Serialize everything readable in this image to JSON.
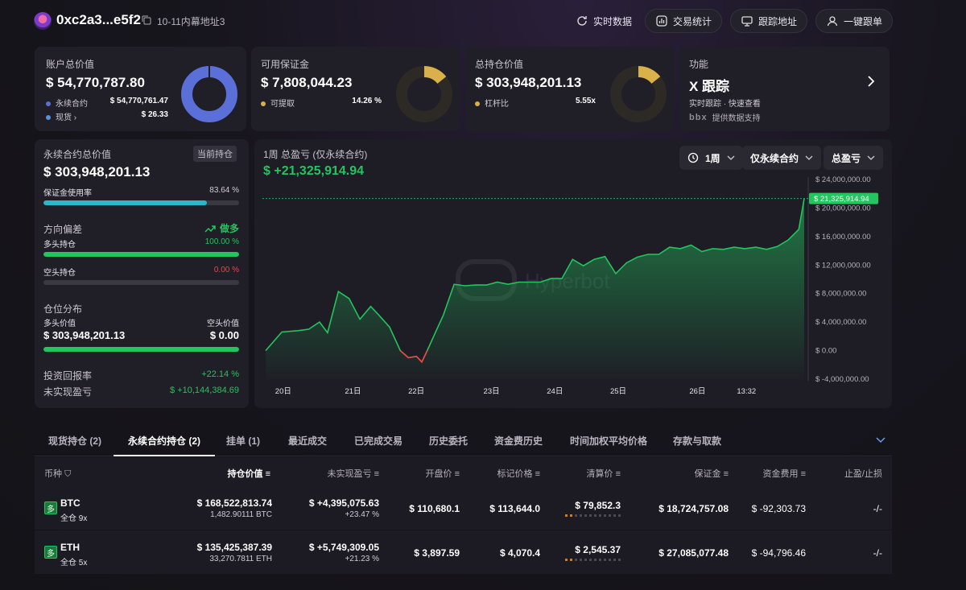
{
  "header": {
    "address": "0xc2a3...e5f2",
    "address_note": "10-11内幕地址3",
    "realtime_label": "实时数据",
    "trade_stats_label": "交易统计",
    "track_address_label": "跟踪地址",
    "copy_trade_label": "一键跟单"
  },
  "cards": {
    "account": {
      "label": "账户总价值",
      "value": "$ 54,770,787.80",
      "perp_label": "永续合约",
      "perp_value": "$ 54,770,761.47",
      "spot_label": "现货",
      "spot_value": "$ 26.33",
      "colors": {
        "perp": "#5b6fd8",
        "spot": "#5b8fe0"
      },
      "ring_fraction": 0.9999
    },
    "margin": {
      "label": "可用保证金",
      "value": "$ 7,808,044.23",
      "withdraw_label": "可提取",
      "withdraw_value": "14.26 %",
      "ring_fraction": 0.1426,
      "color": "#d9b04a"
    },
    "positions": {
      "label": "总持仓价值",
      "value": "$ 303,948,201.13",
      "leverage_label": "杠杆比",
      "leverage_value": "5.55x",
      "ring_fraction": 0.14,
      "color": "#d9b04a"
    },
    "feature": {
      "label": "功能",
      "title": "X 跟踪",
      "desc": "实时跟踪 · 快速查看",
      "provider_logo": "bbx",
      "provider_text": "提供数据支持"
    }
  },
  "left": {
    "perp_total_label": "永续合约总价值",
    "current_pos_label": "当前持仓",
    "perp_total_value": "$ 303,948,201.13",
    "margin_usage_label": "保证金使用率",
    "margin_usage_value": "83.64 %",
    "margin_usage_fraction": 0.8364,
    "direction_label": "方向偏差",
    "direction_value": "做多",
    "long_label": "多头持仓",
    "long_value": "100.00 %",
    "long_fraction": 1.0,
    "short_label": "空头持仓",
    "short_value": "0.00 %",
    "short_fraction": 0.0,
    "distribution_label": "仓位分布",
    "long_value_label": "多头价值",
    "short_value_label": "空头价值",
    "long_amount": "$ 303,948,201.13",
    "short_amount": "$ 0.00",
    "dist_fraction": 1.0,
    "roi_label": "投资回报率",
    "roi_value": "+22.14 %",
    "unrealized_label": "未实现盈亏",
    "unrealized_value": "$ +10,144,384.69"
  },
  "chart_panel": {
    "title": "1周 总盈亏 (仅永续合约)",
    "pnl": "$ +21,325,914.94",
    "period_btn": "1周",
    "scope_btn": "仅永续合约",
    "metric_btn": "总盈亏",
    "watermark": "Hyperbot"
  },
  "chart_data": {
    "type": "area",
    "title": "1周 总盈亏 (仅永续合约)",
    "x_tick_labels": [
      "20日",
      "21日",
      "22日",
      "23日",
      "24日",
      "25日",
      "26日",
      "13:32"
    ],
    "y_tick_labels": [
      "$ 24,000,000.00",
      "$ 20,000,000.00",
      "$ 16,000,000.00",
      "$ 12,000,000.00",
      "$ 8,000,000.00",
      "$ 4,000,000.00",
      "$ 0.00",
      "$ -4,000,000.00"
    ],
    "ylim": [
      -4000000,
      24000000
    ],
    "current_value_label": "$ 21,325,914.94",
    "current_value": 21325914.94,
    "x": [
      0,
      0.3,
      0.6,
      0.8,
      1.0,
      1.15,
      1.35,
      1.55,
      1.75,
      1.95,
      2.1,
      2.3,
      2.5,
      2.65,
      2.8,
      2.9,
      3.0,
      3.15,
      3.3,
      3.5,
      3.7,
      3.9,
      4.1,
      4.3,
      4.5,
      4.7,
      4.9,
      5.1,
      5.3,
      5.5,
      5.7,
      5.9,
      6.1,
      6.3,
      6.5,
      6.7,
      6.9,
      7.1,
      7.3,
      7.5,
      7.7,
      7.9,
      8.1,
      8.3,
      8.5,
      8.7,
      8.9,
      9.1,
      9.3,
      9.5,
      9.7,
      9.9,
      10.0
    ],
    "values": [
      0,
      2600000,
      2800000,
      3000000,
      4000000,
      2500000,
      8300000,
      7300000,
      4400000,
      6200000,
      5000000,
      3300000,
      0,
      -1000000,
      -800000,
      -1600000,
      0,
      2500000,
      5000000,
      9300000,
      9100000,
      9200000,
      9200000,
      9600000,
      9300000,
      9600000,
      9600000,
      9600000,
      10100000,
      10100000,
      12800000,
      11900000,
      12800000,
      13200000,
      10800000,
      12300000,
      13100000,
      13500000,
      13500000,
      14500000,
      14300000,
      14800000,
      13900000,
      14300000,
      14200000,
      14500000,
      14300000,
      14500000,
      14200000,
      14600000,
      15500000,
      17000000,
      21325914.94
    ],
    "series_color": "#22c55e",
    "negative_color": "#ef4444",
    "grid": false
  },
  "tabs": [
    "现货持仓 (2)",
    "永续合约持仓 (2)",
    "挂单 (1)",
    "最近成交",
    "已完成交易",
    "历史委托",
    "资金费历史",
    "时间加权平均价格",
    "存款与取款"
  ],
  "table": {
    "headers": [
      "币种",
      "持仓价值",
      "未实现盈亏",
      "开盘价",
      "标记价格",
      "清算价",
      "保证金",
      "资金费用",
      "止盈/止损"
    ],
    "rows": [
      {
        "side_badge": "多",
        "coin": "BTC",
        "mode": "全仓 9x",
        "value": "$ 168,522,813.74",
        "size": "1,482.90111 BTC",
        "pnl": "$ +4,395,075.63",
        "pnl_pct": "+23.47 %",
        "entry": "$ 110,680.1",
        "mark": "$ 113,644.0",
        "liq": "$ 79,852.3",
        "margin": "$ 18,724,757.08",
        "funding": "$ -92,303.73",
        "tpsl": "-/-"
      },
      {
        "side_badge": "多",
        "coin": "ETH",
        "mode": "全仓 5x",
        "value": "$ 135,425,387.39",
        "size": "33,270.7811 ETH",
        "pnl": "$ +5,749,309.05",
        "pnl_pct": "+21.23 %",
        "entry": "$ 3,897.59",
        "mark": "$ 4,070.4",
        "liq": "$ 2,545.37",
        "margin": "$ 27,085,077.48",
        "funding": "$ -94,796.46",
        "tpsl": "-/-"
      }
    ]
  }
}
